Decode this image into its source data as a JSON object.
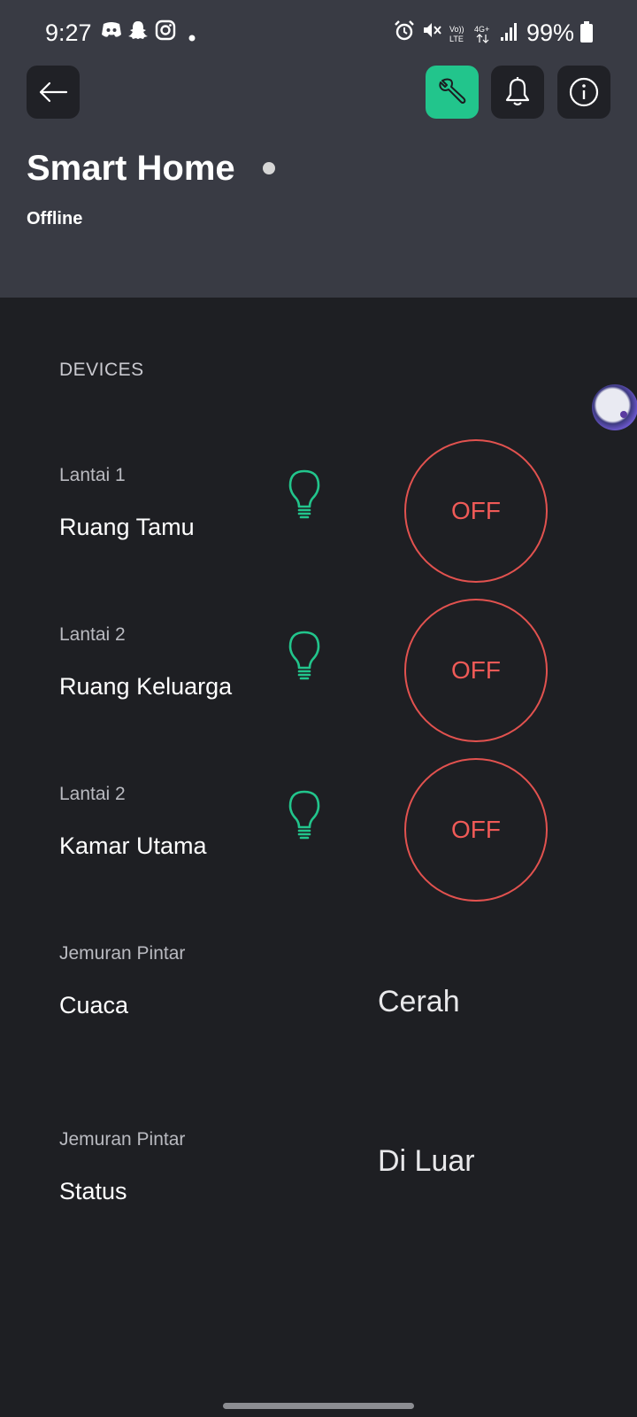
{
  "status_bar": {
    "time": "9:27",
    "battery": "99%",
    "left_icons": [
      "discord-icon",
      "snapchat-icon",
      "instagram-icon",
      "dot-icon"
    ],
    "right_icons": [
      "alarm-icon",
      "mute-icon",
      "volte-icon",
      "4g-icon",
      "signal-icon",
      "battery-icon"
    ]
  },
  "header": {
    "title": "Smart Home",
    "status": "Offline",
    "accent_color": "#22c58c"
  },
  "devices": {
    "label": "DEVICES",
    "items": [
      {
        "category": "Lantai 1",
        "name": "Ruang Tamu",
        "toggle": "OFF"
      },
      {
        "category": "Lantai 2",
        "name": "Ruang Keluarga",
        "toggle": "OFF"
      },
      {
        "category": "Lantai 2",
        "name": "Kamar Utama",
        "toggle": "OFF"
      }
    ],
    "sensors": [
      {
        "category": "Jemuran Pintar",
        "name": "Cuaca",
        "value": "Cerah"
      },
      {
        "category": "Jemuran Pintar",
        "name": "Status",
        "value": "Di Luar"
      }
    ],
    "off_color": "#ef5a57"
  }
}
